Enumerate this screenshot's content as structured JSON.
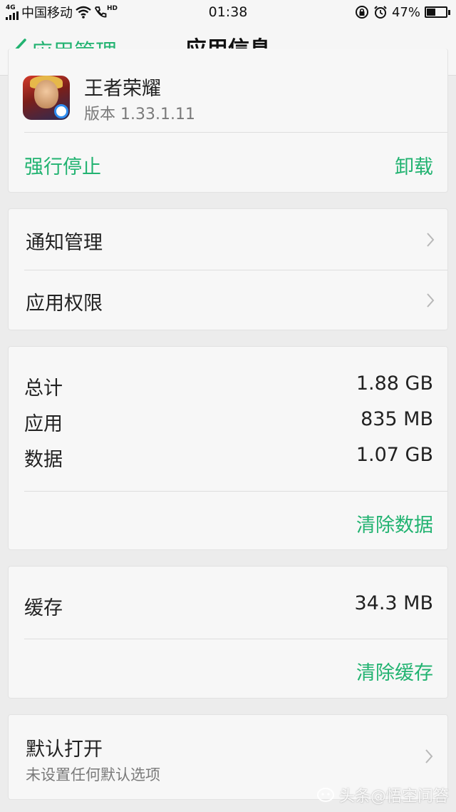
{
  "status_bar": {
    "network_type": "4G",
    "carrier": "中国移动",
    "hd_label": "HD",
    "time": "01:38",
    "battery_text": "47%",
    "battery_level": 0.47,
    "icons": [
      "signal-icon",
      "wifi-icon",
      "volte-call-icon",
      "rotation-lock-icon",
      "alarm-icon",
      "battery-icon"
    ]
  },
  "nav": {
    "back_label": "应用管理",
    "title": "应用信息"
  },
  "app": {
    "name": "王者荣耀",
    "version": "版本 1.33.1.11",
    "force_stop": "强行停止",
    "uninstall": "卸载"
  },
  "settings": [
    {
      "label": "通知管理"
    },
    {
      "label": "应用权限"
    }
  ],
  "storage": {
    "rows": [
      {
        "label": "总计",
        "value": "1.88 GB"
      },
      {
        "label": "应用",
        "value": "835 MB"
      },
      {
        "label": "数据",
        "value": "1.07 GB"
      }
    ],
    "clear_data": "清除数据"
  },
  "cache": {
    "label": "缓存",
    "value": "34.3 MB",
    "clear_cache": "清除缓存"
  },
  "default_open": {
    "title": "默认打开",
    "subtitle": "未设置任何默认选项"
  },
  "watermark": "头条@悟空问答",
  "colors": {
    "accent": "#22b371",
    "background": "#ececec",
    "card": "#f7f7f7"
  }
}
